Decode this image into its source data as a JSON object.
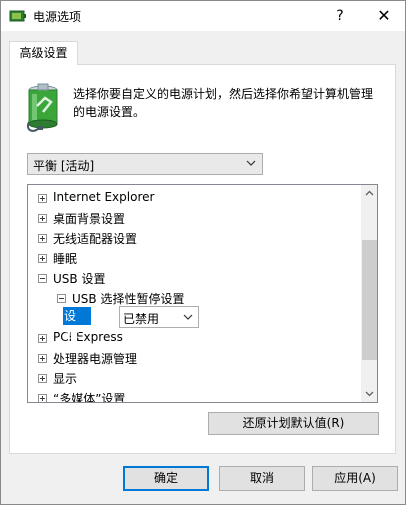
{
  "window": {
    "title": "电源选项"
  },
  "title_buttons": {
    "help": "?",
    "close": "✕"
  },
  "tab": {
    "label": "高级设置"
  },
  "description": {
    "text": "选择你要自定义的电源计划，然后选择你希望计算机管理的电源设置。"
  },
  "plan": {
    "selected": "平衡 [活动]"
  },
  "tree": {
    "items": [
      {
        "label": "Internet Explorer",
        "expanded": false
      },
      {
        "label": "桌面背景设置",
        "expanded": false
      },
      {
        "label": "无线适配器设置",
        "expanded": false
      },
      {
        "label": "睡眠",
        "expanded": false
      },
      {
        "label": "USB 设置",
        "expanded": true
      },
      {
        "label": "USB 选择性暂停设置",
        "expanded": true
      },
      {
        "label": "PCI Express",
        "expanded": false
      },
      {
        "label": "处理器电源管理",
        "expanded": false
      },
      {
        "label": "显示",
        "expanded": false
      },
      {
        "label": "“多媒体”设置",
        "expanded": false
      }
    ],
    "setting_label": "设置:",
    "setting_value": "已禁用"
  },
  "restore_button": "还原计划默认值(R)",
  "footer": {
    "ok": "确定",
    "cancel": "取消",
    "apply": "应用(A)"
  },
  "colors": {
    "accent": "#0078d7",
    "battery": "#3aa63a"
  }
}
